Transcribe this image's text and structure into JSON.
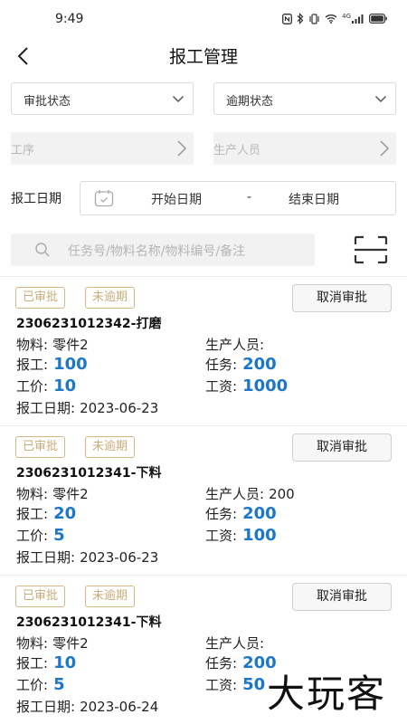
{
  "status_bar": {
    "time": "9:49",
    "icons": [
      "nfc-icon",
      "bluetooth-icon",
      "vibrate-icon",
      "wifi-icon",
      "4g-signal-icon",
      "battery-icon"
    ],
    "network": "4G"
  },
  "header": {
    "title": "报工管理",
    "back_icon": "chevron-left-icon"
  },
  "filters": {
    "approval_status": "审批状态",
    "overdue_status": "逾期状态",
    "process": "工序",
    "producer": "生产人员",
    "date_label": "报工日期",
    "start_date": "开始日期",
    "date_separator": "-",
    "end_date": "结束日期",
    "search_placeholder": "任务号/物料名称/物料编号/备注"
  },
  "labels": {
    "material": "物料:",
    "producer": "生产人员:",
    "report": "报工:",
    "task": "任务:",
    "unit_price": "工价:",
    "wage": "工资:",
    "report_date": "报工日期:",
    "cancel": "取消审批"
  },
  "records": [
    {
      "tags": [
        "已审批",
        "未逾期"
      ],
      "title": "2306231012342-打磨",
      "material": "零件2",
      "producer": "",
      "report": "100",
      "task": "200",
      "unit_price": "10",
      "wage": "1000",
      "date": "2023-06-23"
    },
    {
      "tags": [
        "已审批",
        "未逾期"
      ],
      "title": "2306231012341-下料",
      "material": "零件2",
      "producer": "200",
      "report": "20",
      "task": "200",
      "unit_price": "5",
      "wage": "100",
      "date": "2023-06-23"
    },
    {
      "tags": [
        "已审批",
        "未逾期"
      ],
      "title": "2306231012341-下料",
      "material": "零件2",
      "producer": "",
      "report": "10",
      "task": "200",
      "unit_price": "5",
      "wage": "50",
      "date": "2023-06-24"
    }
  ],
  "watermark": "大玩客",
  "colors": {
    "accent_blue": "#1a77c9",
    "tag_gold": "#c8ad79"
  }
}
